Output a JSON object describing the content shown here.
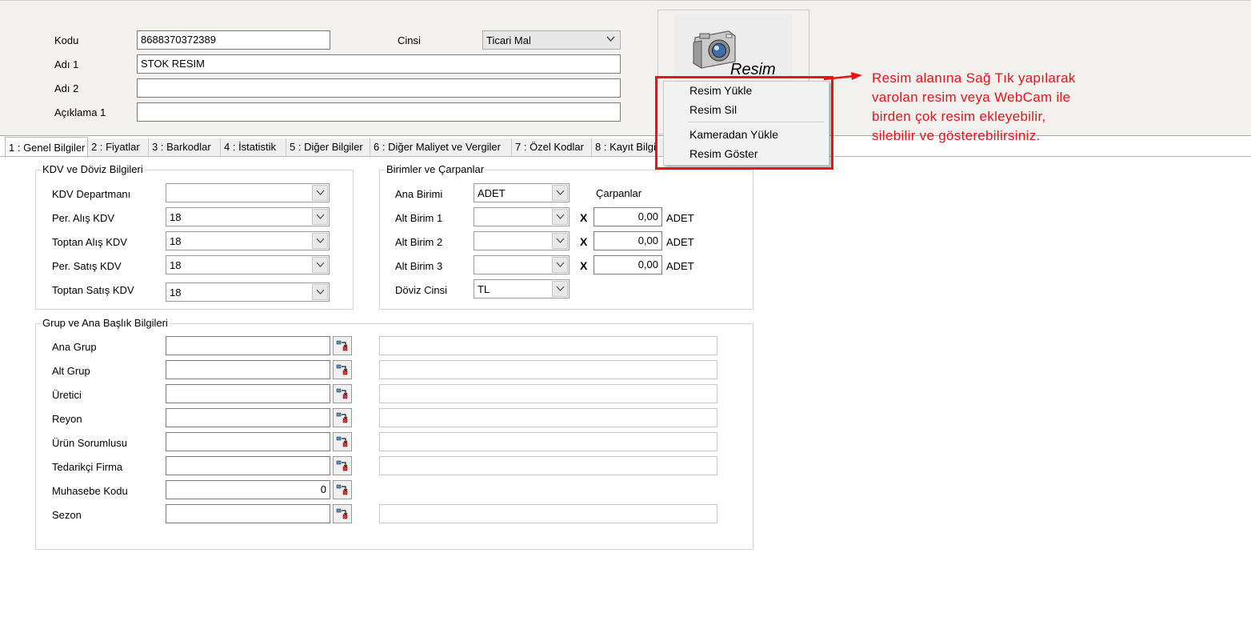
{
  "header": {
    "kodu_label": "Kodu",
    "kodu_value": "8688370372389",
    "cinsi_label": "Cinsi",
    "cinsi_value": "Ticari Mal",
    "adi1_label": "Adı 1",
    "adi1_value": "STOK RESIM",
    "adi2_label": "Adı 2",
    "adi2_value": "",
    "aciklama1_label": "Açıklama 1",
    "aciklama1_value": "",
    "image_caption": "Resim"
  },
  "context_menu": {
    "items": [
      "Resim Yükle",
      "Resim Sil",
      "Kameradan Yükle",
      "Resim Göster"
    ]
  },
  "annotation": {
    "lines": [
      "Resim alanına Sağ Tık yapılarak",
      "varolan resim veya WebCam ile",
      "birden çok resim ekleyebilir,",
      "silebilir ve gösterebilirsiniz."
    ],
    "color": "#e0161b"
  },
  "tabs": [
    "1 : Genel Bilgiler",
    "2 : Fiyatlar",
    "3 : Barkodlar",
    "4 : İstatistik",
    "5 : Diğer Bilgiler",
    "6 : Diğer Maliyet ve Vergiler",
    "7 : Özel Kodlar",
    "8 : Kayıt Bilgi"
  ],
  "kdv_group": {
    "title": "KDV ve Döviz Bilgileri",
    "rows": [
      {
        "label": "KDV Departmanı",
        "value": ""
      },
      {
        "label": "Per. Alış KDV",
        "value": "18"
      },
      {
        "label": "Toptan Alış KDV",
        "value": "18"
      },
      {
        "label": "Per. Satış KDV",
        "value": "18"
      },
      {
        "label": "Toptan Satış KDV",
        "value": "18"
      }
    ]
  },
  "birim_group": {
    "title": "Birimler ve Çarpanlar",
    "carpanlar_label": "Çarpanlar",
    "x_symbol": "X",
    "rows": [
      {
        "label": "Ana Birimi",
        "value": "ADET"
      },
      {
        "label": "Alt Birim 1",
        "value": "",
        "factor": "0,00",
        "unit": "ADET"
      },
      {
        "label": "Alt Birim 2",
        "value": "",
        "factor": "0,00",
        "unit": "ADET"
      },
      {
        "label": "Alt Birim 3",
        "value": "",
        "factor": "0,00",
        "unit": "ADET"
      },
      {
        "label": "Döviz Cinsi",
        "value": "TL"
      }
    ]
  },
  "grup_group": {
    "title": "Grup ve Ana Başlık Bilgileri",
    "rows": [
      {
        "label": "Ana Grup",
        "value": "",
        "desc": ""
      },
      {
        "label": "Alt Grup",
        "value": "",
        "desc": ""
      },
      {
        "label": "Üretici",
        "value": "",
        "desc": ""
      },
      {
        "label": "Reyon",
        "value": "",
        "desc": ""
      },
      {
        "label": "Ürün Sorumlusu",
        "value": "",
        "desc": ""
      },
      {
        "label": "Tedarikçi Firma",
        "value": "",
        "desc": ""
      },
      {
        "label": "Muhasebe Kodu",
        "value": "0"
      },
      {
        "label": "Sezon",
        "value": "",
        "desc": ""
      }
    ]
  }
}
